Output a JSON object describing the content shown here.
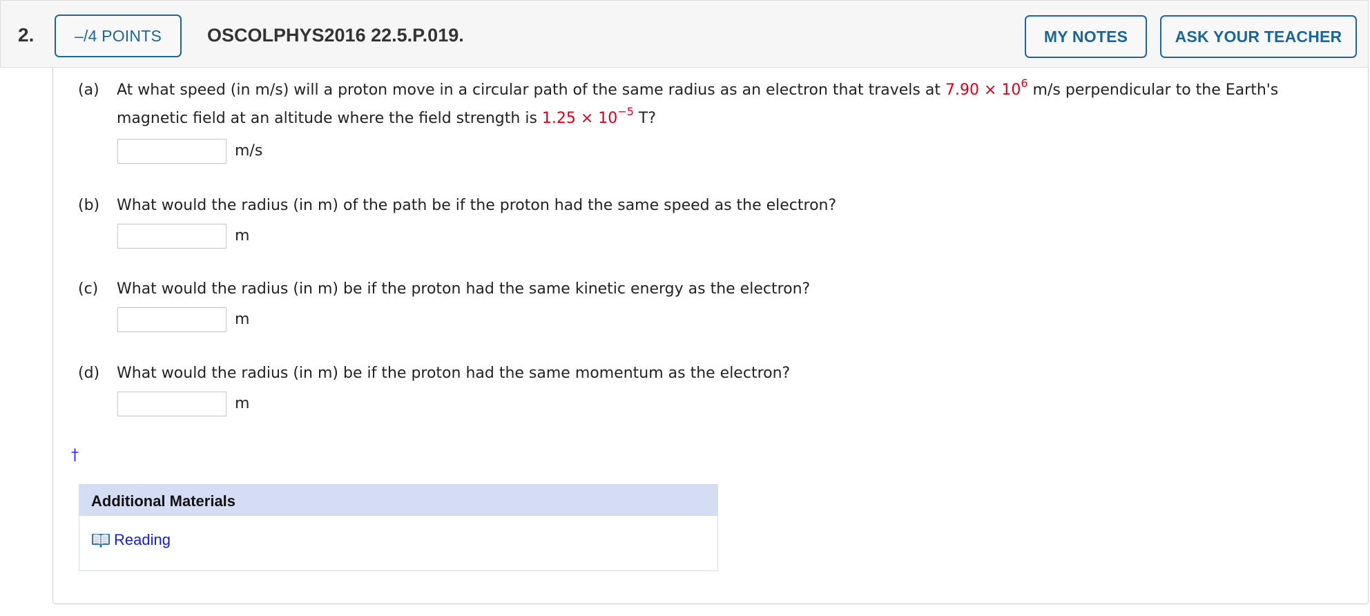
{
  "header": {
    "question_number": "2.",
    "points_label": "–/4 POINTS",
    "title": "OSCOLPHYS2016 22.5.P.019.",
    "my_notes_label": "MY NOTES",
    "ask_teacher_label": "ASK YOUR TEACHER"
  },
  "parts": [
    {
      "label": "(a)",
      "text_1": "At what speed (in m/s) will a proton move in a circular path of the same radius as an electron that travels at ",
      "value_1_base": "7.90 × 10",
      "value_1_exp": "6",
      "text_2": " m/s perpendicular to the Earth's",
      "text_3": "magnetic field at an altitude where the field strength is ",
      "value_2_base": "1.25 × 10",
      "value_2_exp": "−5",
      "text_4": " T?",
      "input_value": "",
      "unit": "m/s"
    },
    {
      "label": "(b)",
      "text": "What would the radius (in m) of the path be if the proton had the same speed as the electron?",
      "input_value": "",
      "unit": "m"
    },
    {
      "label": "(c)",
      "text": "What would the radius (in m) be if the proton had the same kinetic energy as the electron?",
      "input_value": "",
      "unit": "m"
    },
    {
      "label": "(d)",
      "text": "What would the radius (in m) be if the proton had the same momentum as the electron?",
      "input_value": "",
      "unit": "m"
    }
  ],
  "footnote_symbol": "†",
  "materials": {
    "header": "Additional Materials",
    "links": [
      {
        "label": "Reading",
        "icon": "book-icon"
      }
    ]
  },
  "colors": {
    "accent": "#1b6696",
    "given_value": "#d0021b",
    "link": "#1520c4",
    "materials_header_bg": "#d5ddf4"
  }
}
